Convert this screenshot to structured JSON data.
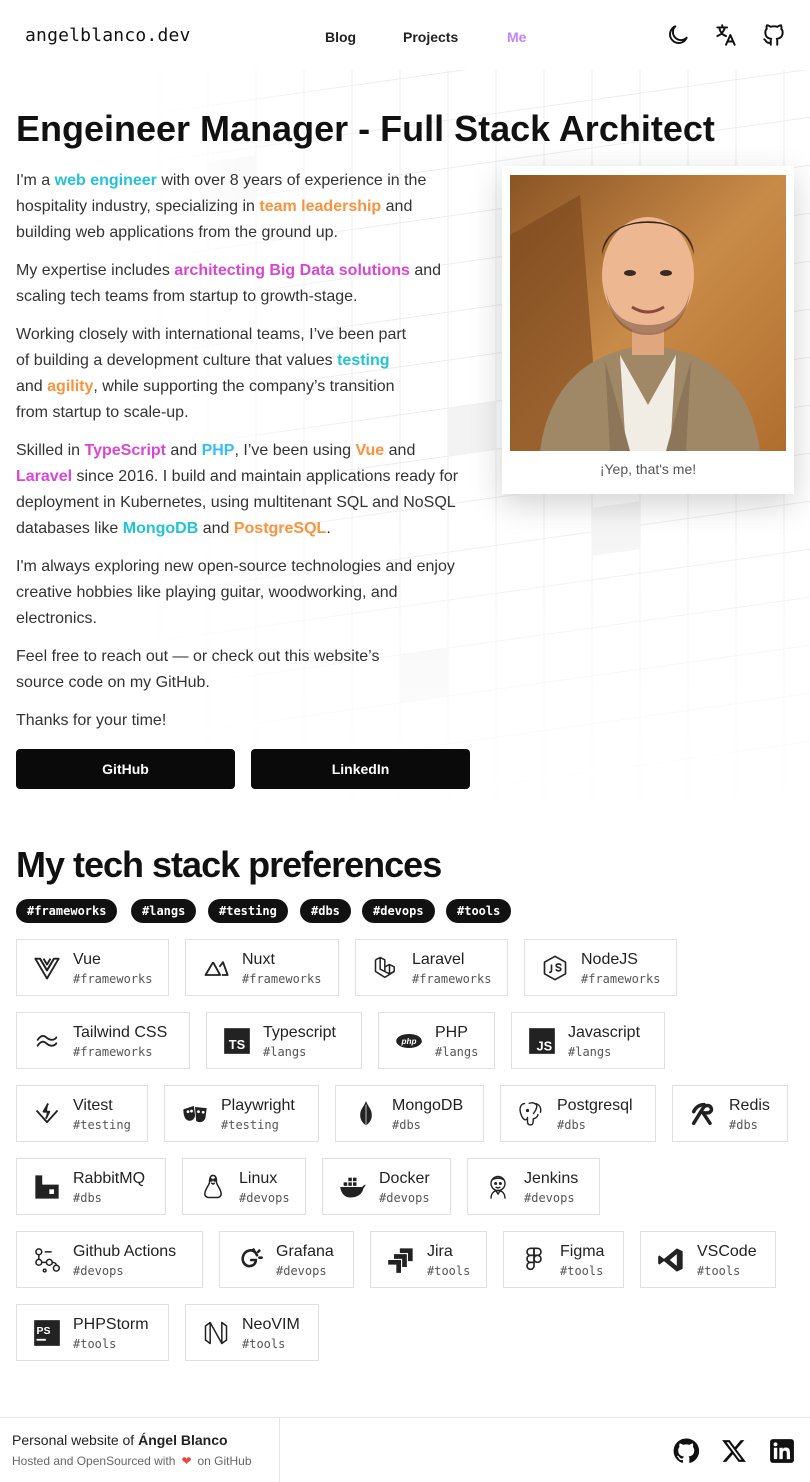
{
  "header": {
    "logo": "angelblanco.dev",
    "nav": [
      {
        "label": "Blog"
      },
      {
        "label": "Projects"
      },
      {
        "label": "Me"
      }
    ],
    "icons": [
      "moon-icon",
      "translate-icon",
      "github-icon"
    ]
  },
  "hero": {
    "title": "Engeineer Manager - Full Stack Architect",
    "p1": {
      "a": "I'm a ",
      "b": "web engineer",
      "c": " with over 8 years of experience in the hospitality industry, specializing in ",
      "d": "team leadership",
      "e": " and building web applications from the ground up."
    },
    "p2": {
      "a": "My expertise includes ",
      "b": "architecting Big Data solutions",
      "c": " and scaling tech teams from startup to growth-stage."
    },
    "p3": {
      "a": "Working closely with international teams, I’ve been part of building a development culture that values ",
      "b": "testing",
      "c": " and ",
      "d": "agility",
      "e": ", while supporting the company’s transition from startup to scale-up."
    },
    "p4": {
      "a": "Skilled in ",
      "b": "TypeScript",
      "c": " and ",
      "d": "PHP",
      "e": ", I’ve been using ",
      "f": "Vue",
      "g": " and ",
      "h": "Laravel",
      "i": " since 2016. I build and maintain applications ready for deployment in Kubernetes, using multitenant SQL and NoSQL databases like ",
      "j": "MongoDB",
      "k": " and ",
      "l": "PostgreSQL",
      "m": "."
    },
    "p5": "I'm always exploring new open-source technologies and enjoy creative hobbies like playing guitar, woodworking, and electronics.",
    "p6": "Feel free to reach out — or check out this website’s source code on my GitHub.",
    "p7": "Thanks for your time!",
    "buttons": {
      "github": "GitHub",
      "linkedin": "LinkedIn"
    },
    "caption": "¡Yep, that's me!"
  },
  "tech": {
    "title": "My tech stack preferences",
    "tags": [
      "#frameworks",
      "#langs",
      "#testing",
      "#dbs",
      "#devops",
      "#tools"
    ],
    "items": [
      {
        "name": "Vue",
        "tag": "#frameworks",
        "icon": "vue-icon"
      },
      {
        "name": "Nuxt",
        "tag": "#frameworks",
        "icon": "nuxt-icon"
      },
      {
        "name": "Laravel",
        "tag": "#frameworks",
        "icon": "laravel-icon"
      },
      {
        "name": "NodeJS",
        "tag": "#frameworks",
        "icon": "nodejs-icon"
      },
      {
        "name": "Tailwind CSS",
        "tag": "#frameworks",
        "icon": "tailwind-icon"
      },
      {
        "name": "Typescript",
        "tag": "#langs",
        "icon": "typescript-icon"
      },
      {
        "name": "PHP",
        "tag": "#langs",
        "icon": "php-icon"
      },
      {
        "name": "Javascript",
        "tag": "#langs",
        "icon": "javascript-icon"
      },
      {
        "name": "Vitest",
        "tag": "#testing",
        "icon": "vitest-icon"
      },
      {
        "name": "Playwright",
        "tag": "#testing",
        "icon": "playwright-icon"
      },
      {
        "name": "MongoDB",
        "tag": "#dbs",
        "icon": "mongodb-icon"
      },
      {
        "name": "Postgresql",
        "tag": "#dbs",
        "icon": "postgresql-icon"
      },
      {
        "name": "Redis",
        "tag": "#dbs",
        "icon": "redis-icon"
      },
      {
        "name": "RabbitMQ",
        "tag": "#dbs",
        "icon": "rabbitmq-icon"
      },
      {
        "name": "Linux",
        "tag": "#devops",
        "icon": "linux-icon"
      },
      {
        "name": "Docker",
        "tag": "#devops",
        "icon": "docker-icon"
      },
      {
        "name": "Jenkins",
        "tag": "#devops",
        "icon": "jenkins-icon"
      },
      {
        "name": "Github Actions",
        "tag": "#devops",
        "icon": "github-actions-icon"
      },
      {
        "name": "Grafana",
        "tag": "#devops",
        "icon": "grafana-icon"
      },
      {
        "name": "Jira",
        "tag": "#tools",
        "icon": "jira-icon"
      },
      {
        "name": "Figma",
        "tag": "#tools",
        "icon": "figma-icon"
      },
      {
        "name": "VSCode",
        "tag": "#tools",
        "icon": "vscode-icon"
      },
      {
        "name": "PHPStorm",
        "tag": "#tools",
        "icon": "phpstorm-icon"
      },
      {
        "name": "NeoVIM",
        "tag": "#tools",
        "icon": "neovim-icon"
      }
    ]
  },
  "footer": {
    "line1_prefix": "Personal website of ",
    "line1_name": "Ángel Blanco",
    "line2_prefix": "Hosted and OpenSourced with",
    "line2_suffix": "on GitHub",
    "icons": [
      "github-icon",
      "x-icon",
      "linkedin-icon"
    ]
  },
  "colors": {
    "accent_nav": "#c084fc",
    "cyan": "#22c3d6",
    "orange": "#fb923c",
    "pink": "#d946d4",
    "sky": "#38bdf8",
    "button": "#0a0a0a"
  }
}
